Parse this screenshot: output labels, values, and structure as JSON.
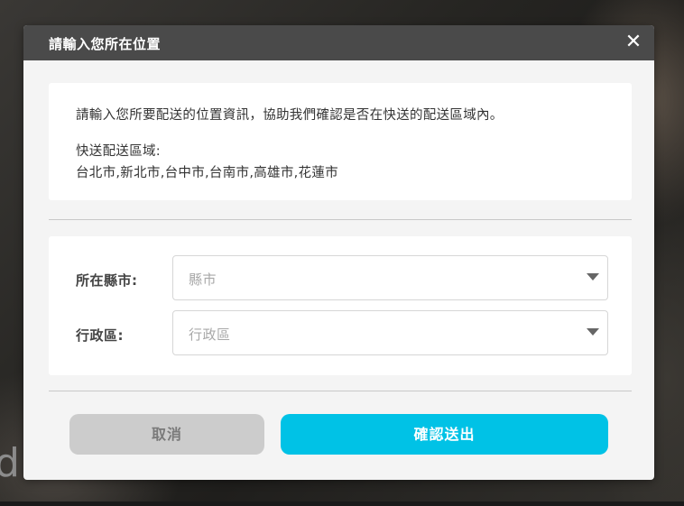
{
  "background": {
    "partial_text": "d"
  },
  "modal": {
    "title": "請輸入您所在位置",
    "close_icon": "close-icon",
    "info": {
      "description": "請輸入您所要配送的位置資訊，協助我們確認是否在快送的配送區域內。",
      "zone_label": "快送配送區域:",
      "zone_list": "台北市,新北市,台中市,台南市,高雄市,花蓮市"
    },
    "form": {
      "city_label": "所在縣市:",
      "city_placeholder": "縣市",
      "district_label": "行政區:",
      "district_placeholder": "行政區"
    },
    "buttons": {
      "cancel": "取消",
      "confirm": "確認送出"
    }
  },
  "colors": {
    "header_bg": "#4a4a4a",
    "confirm_bg": "#00c2e6",
    "cancel_bg": "#cccccc",
    "modal_bg": "#f4f4f4"
  }
}
